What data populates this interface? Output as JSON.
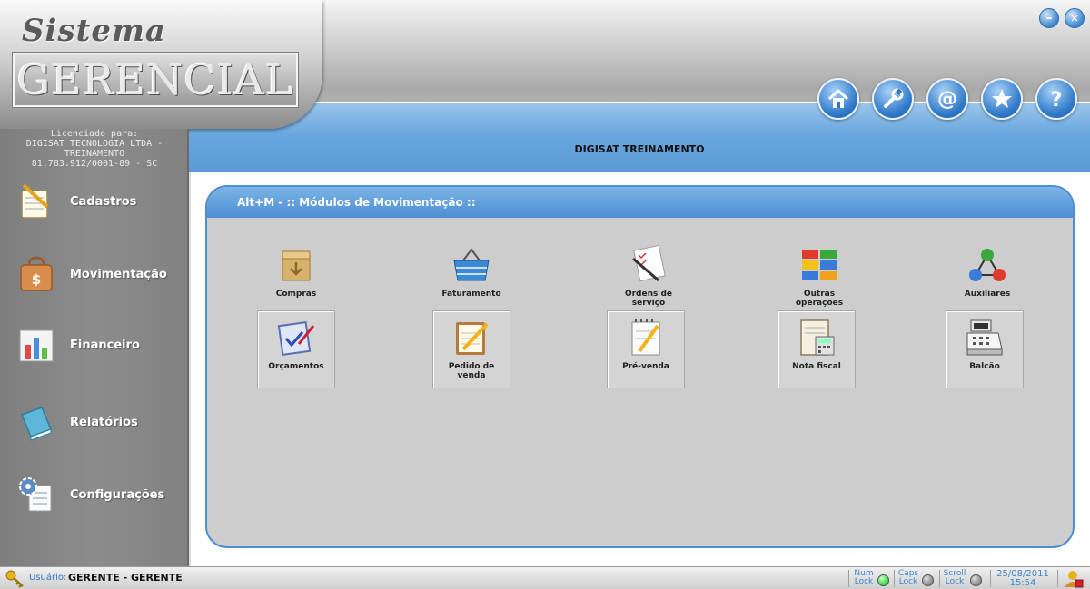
{
  "header": {
    "logo_script": "Sistema",
    "logo_main": "GERENCIAL",
    "company": "DIGISAT TREINAMENTO",
    "window_buttons": [
      {
        "name": "minimize-icon",
        "glyph": "–"
      },
      {
        "name": "close-icon",
        "glyph": "✕"
      }
    ],
    "toolbar": [
      {
        "name": "home-icon"
      },
      {
        "name": "wrench-icon"
      },
      {
        "name": "at-sign-icon"
      },
      {
        "name": "star-icon"
      },
      {
        "name": "help-icon"
      }
    ]
  },
  "license": {
    "heading": "Licenciado para:",
    "line1": "DIGISAT TECNOLOGIA LTDA -",
    "line2": "TREINAMENTO",
    "line3": "81.783.912/0001-89 - SC"
  },
  "sidebar": {
    "items": [
      {
        "label": "Cadastros",
        "icon": "notebook-pencil-icon"
      },
      {
        "label": "Movimentação",
        "icon": "shopping-bag-icon"
      },
      {
        "label": "Financeiro",
        "icon": "bar-chart-icon"
      },
      {
        "label": "Relatórios",
        "icon": "book-icon"
      },
      {
        "label": "Configurações",
        "icon": "gear-document-icon"
      }
    ]
  },
  "panel": {
    "title": "Alt+M - :: Módulos de Movimentação ::",
    "modules": [
      {
        "label": "Compras",
        "icon": "box-arrow-icon"
      },
      {
        "label": "Faturamento",
        "icon": "basket-icon"
      },
      {
        "label": "Ordens de serviço",
        "icon": "checklist-pen-icon"
      },
      {
        "label": "Outras operações",
        "icon": "color-grid-icon"
      },
      {
        "label": "Auxiliares",
        "icon": "molecule-icon"
      },
      {
        "label": "Orçamentos",
        "icon": "clipboard-check-icon"
      },
      {
        "label": "Pedido de venda",
        "icon": "notepad-pencil-icon"
      },
      {
        "label": "Pré-venda",
        "icon": "spiral-notepad-icon"
      },
      {
        "label": "Nota fiscal",
        "icon": "invoice-calculator-icon"
      },
      {
        "label": "Balcão",
        "icon": "cash-register-icon"
      }
    ]
  },
  "statusbar": {
    "user_label": "Usuário:",
    "user_value": "GERENTE - GERENTE",
    "num_lock": "Num Lock",
    "caps_lock": "Caps Lock",
    "scroll_lock": "Scroll Lock",
    "num_lock_on": true,
    "caps_lock_on": false,
    "scroll_lock_on": false,
    "date": "25/08/2011",
    "time": "15:54"
  },
  "colors": {
    "accent_blue": "#4d8ed3",
    "sidebar_gray": "#8c8c8c",
    "panel_gray": "#cdcdcd",
    "led_on": "#2fd82f",
    "led_off": "#8a8a8a"
  }
}
